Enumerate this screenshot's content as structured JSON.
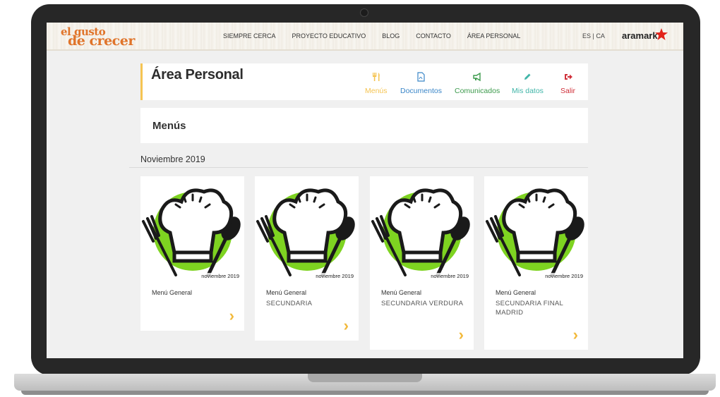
{
  "logo": {
    "line1": "el gusto",
    "line2": "de crecer"
  },
  "nav": [
    "SIEMPRE CERCA",
    "PROYECTO EDUCATIVO",
    "BLOG",
    "CONTACTO",
    "ÁREA PERSONAL"
  ],
  "lang": "ES | CA",
  "brand": "aramark",
  "area": {
    "title": "Área Personal"
  },
  "tabs": [
    {
      "label": "Menús",
      "icon": "cutlery-icon",
      "color": "#f5c452"
    },
    {
      "label": "Documentos",
      "icon": "pdf-file-icon",
      "color": "#3a86c8"
    },
    {
      "label": "Comunicados",
      "icon": "megaphone-icon",
      "color": "#3c9a4c"
    },
    {
      "label": "Mis datos",
      "icon": "pencil-icon",
      "color": "#40b5a8"
    },
    {
      "label": "Salir",
      "icon": "logout-icon",
      "color": "#d0303a"
    }
  ],
  "section_title": "Menús",
  "month": "Noviembre 2019",
  "cards": [
    {
      "date": "noviembre 2019",
      "title": "Menú General",
      "subtitle": ""
    },
    {
      "date": "noviembre 2019",
      "title": "Menú General",
      "subtitle": "SECUNDARIA"
    },
    {
      "date": "noviembre 2019",
      "title": "Menú General",
      "subtitle": "SECUNDARIA VERDURA"
    },
    {
      "date": "noviembre 2019",
      "title": "Menú General",
      "subtitle": "SECUNDARIA FINAL MADRID"
    }
  ],
  "colors": {
    "accent": "#f5c452",
    "arrow": "#f2b93b",
    "chef_green": "#7ed321",
    "logo_orange": "#e0742a"
  }
}
